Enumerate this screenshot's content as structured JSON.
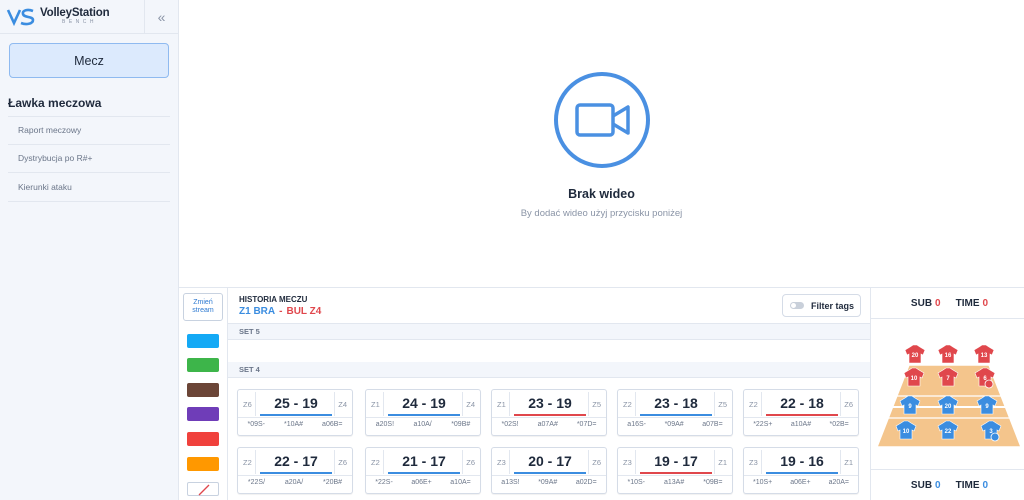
{
  "logo": {
    "main": "VolleyStation",
    "sub": "BENCH"
  },
  "sidebar": {
    "collapse_icon": "chevrons-left-icon",
    "mecz_label": "Mecz",
    "section_title": "Ławka meczowa",
    "items": [
      {
        "label": "Raport meczowy"
      },
      {
        "label": "Dystrybucja po R#+"
      },
      {
        "label": "Kierunki ataku"
      }
    ]
  },
  "video": {
    "icon": "video-camera-icon",
    "title": "Brak wideo",
    "subtitle": "By dodać wideo użyj przycisku poniżej"
  },
  "tools": {
    "stream_label_1": "Zmień",
    "stream_label_2": "stream",
    "colors": [
      "#14a9f5",
      "#3db54a",
      "#6b4537",
      "#6f3db8",
      "#f0413c",
      "#ff9800"
    ],
    "eraser_icon": "eraser-slash-icon"
  },
  "history": {
    "label": "HISTORIA MECZU",
    "team_a": "Z1 BRA",
    "separator": "-",
    "team_b": "BUL Z4",
    "filter_label": "Filter tags",
    "set5_label": "SET 5",
    "set4_label": "SET 4",
    "colors": {
      "blue": "#3b8de0",
      "red": "#e0474c"
    },
    "row1": [
      {
        "zl": "Z6",
        "score": "25 - 19",
        "zr": "Z4",
        "bar": "blue",
        "codes": [
          "*09S-",
          "*10A#",
          "a06B="
        ]
      },
      {
        "zl": "Z1",
        "score": "24 - 19",
        "zr": "Z4",
        "bar": "blue",
        "codes": [
          "a20S!",
          "a10A/",
          "*09B#"
        ]
      },
      {
        "zl": "Z1",
        "score": "23 - 19",
        "zr": "Z5",
        "bar": "red",
        "codes": [
          "*02S!",
          "a07A#",
          "*07D="
        ]
      },
      {
        "zl": "Z2",
        "score": "23 - 18",
        "zr": "Z5",
        "bar": "blue",
        "codes": [
          "a16S-",
          "*09A#",
          "a07B="
        ]
      },
      {
        "zl": "Z2",
        "score": "22 - 18",
        "zr": "Z6",
        "bar": "red",
        "codes": [
          "*22S+",
          "a10A#",
          "*02B="
        ]
      }
    ],
    "row2": [
      {
        "zl": "Z2",
        "score": "22 - 17",
        "zr": "Z6",
        "bar": "blue",
        "codes": [
          "*22S/",
          "a20A/",
          "*20B#"
        ]
      },
      {
        "zl": "Z2",
        "score": "21 - 17",
        "zr": "Z6",
        "bar": "blue",
        "codes": [
          "*22S-",
          "a06E+",
          "a10A="
        ]
      },
      {
        "zl": "Z3",
        "score": "20 - 17",
        "zr": "Z6",
        "bar": "blue",
        "codes": [
          "a13S!",
          "*09A#",
          "a02D="
        ]
      },
      {
        "zl": "Z3",
        "score": "19 - 17",
        "zr": "Z1",
        "bar": "red",
        "codes": [
          "*10S-",
          "a13A#",
          "*09B="
        ]
      },
      {
        "zl": "Z3",
        "score": "19 - 16",
        "zr": "Z1",
        "bar": "blue",
        "codes": [
          "*10S+",
          "a06E+",
          "a20A="
        ]
      }
    ]
  },
  "court": {
    "top": {
      "sub_label": "SUB",
      "sub_value": "0",
      "time_label": "TIME",
      "time_value": "0"
    },
    "bottom": {
      "sub_label": "SUB",
      "sub_value": "0",
      "time_label": "TIME",
      "time_value": "0"
    },
    "red_team": [
      "20",
      "16",
      "13",
      "10",
      "7",
      "6"
    ],
    "blue_team": [
      "9",
      "20",
      "9",
      "10",
      "22",
      "3"
    ],
    "colors": {
      "red": "#e0474c",
      "blue": "#3b8de0",
      "floor": "#f4c58c",
      "line": "#ffffff"
    }
  }
}
